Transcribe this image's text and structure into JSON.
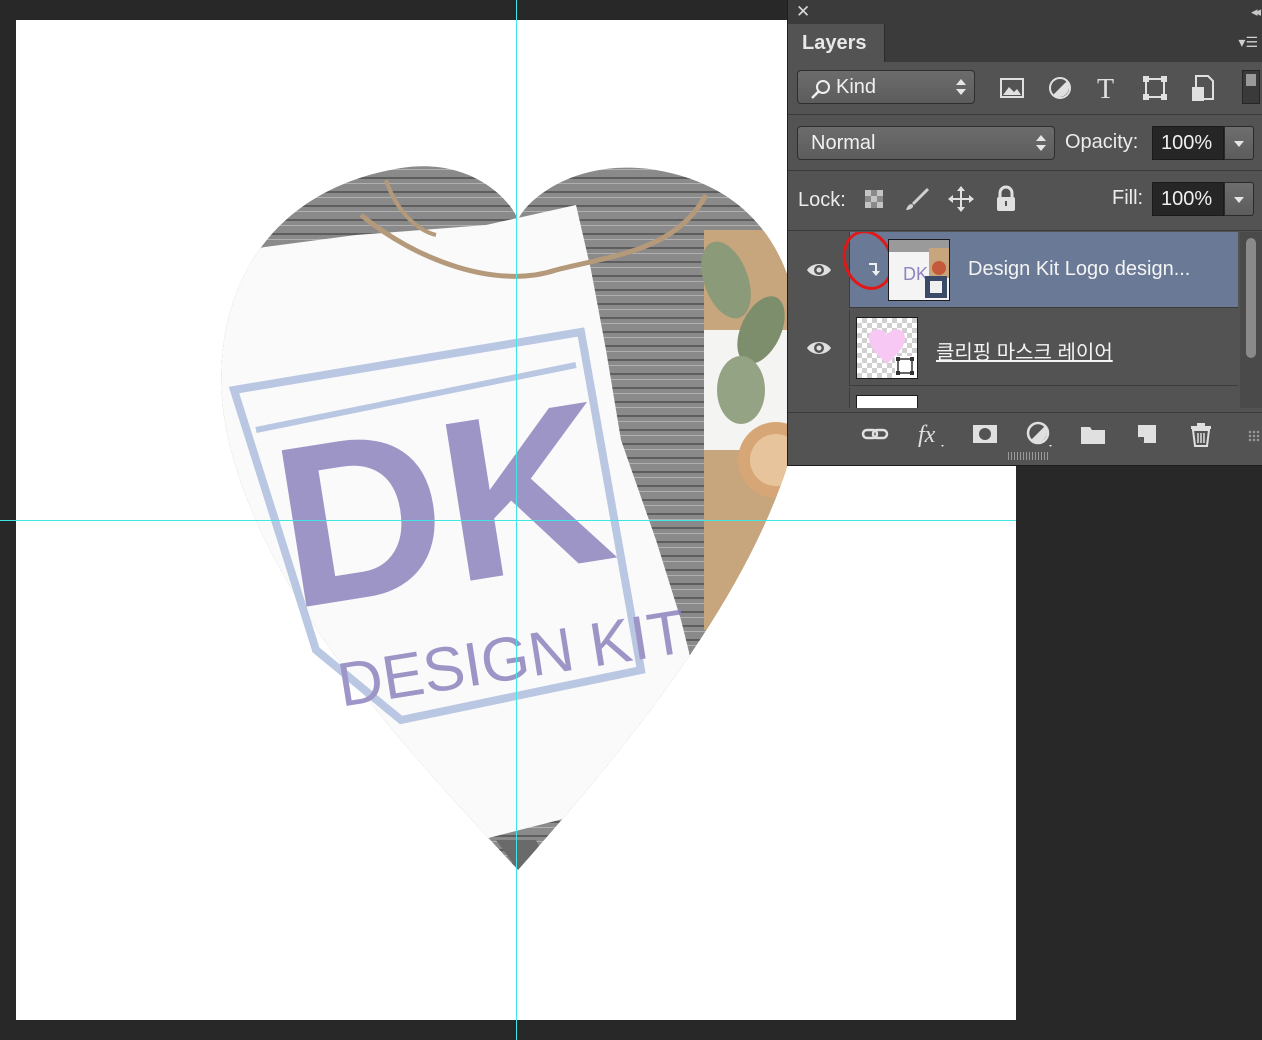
{
  "panel": {
    "tab_label": "Layers",
    "filter": {
      "kind_label": "Kind",
      "icons": [
        "image-filter-icon",
        "adjustment-filter-icon",
        "type-filter-icon",
        "shape-filter-icon",
        "smart-object-filter-icon"
      ]
    },
    "blend": {
      "mode": "Normal",
      "opacity_label": "Opacity:",
      "opacity_value": "100%"
    },
    "lock": {
      "label": "Lock:",
      "fill_label": "Fill:",
      "fill_value": "100%"
    },
    "layers": [
      {
        "name": "Design Kit Logo design...",
        "visible": true,
        "selected": true,
        "clipped": true,
        "smart_object": true
      },
      {
        "name": "클리핑 마스크 레이어",
        "visible": true,
        "selected": false,
        "clipped": false,
        "shape": true
      }
    ],
    "bottom_icons": [
      "link-layers-icon",
      "layer-effects-icon",
      "add-mask-icon",
      "new-adjustment-icon",
      "new-group-icon",
      "new-layer-icon",
      "delete-layer-icon"
    ]
  },
  "colors": {
    "accent_selected_layer": "#6a7a96",
    "guide": "#3ee6e6",
    "annotation_circle": "#e01818",
    "logo_purple": "#8e84bf",
    "logo_blue": "#aebfe0"
  },
  "canvas": {
    "logo_text_main": "DK",
    "logo_text_sub": "DESIGN KIT"
  }
}
